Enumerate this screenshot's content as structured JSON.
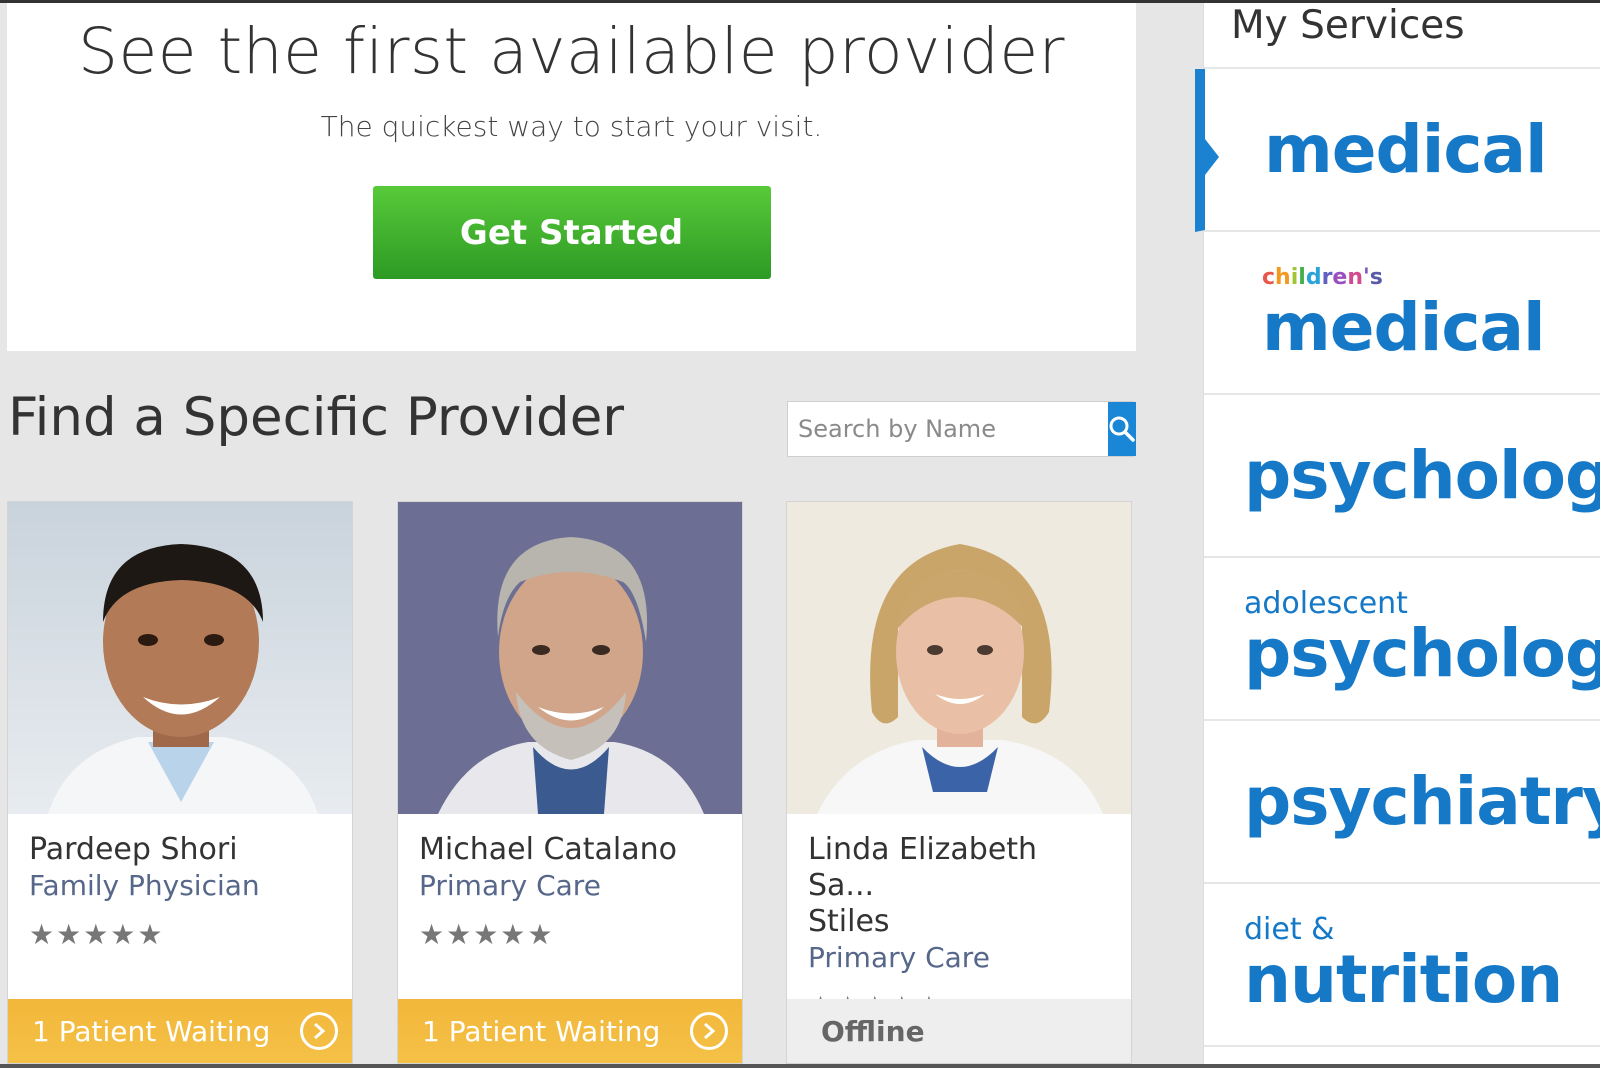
{
  "hero": {
    "title": "See the first available provider",
    "subtitle": "The quickest way to start your visit.",
    "cta_label": "Get Started"
  },
  "find": {
    "title": "Find a Specific Provider",
    "search_placeholder": "Search by Name"
  },
  "providers": [
    {
      "name": "Pardeep Shori",
      "specialty": "Family Physician",
      "stars": "★★★★★",
      "status": "1 Patient Waiting"
    },
    {
      "name": "Michael Catalano",
      "specialty": "Primary Care",
      "stars": "★★★★★",
      "status": "1 Patient Waiting"
    },
    {
      "name": "Linda Elizabeth Sa...",
      "name_line2": "Stiles",
      "specialty": "Primary Care",
      "stars": "★★★★★",
      "status": "Offline"
    }
  ],
  "services": {
    "title": "My Services",
    "items": [
      {
        "pre": "",
        "main": "medical"
      },
      {
        "pre": "children's",
        "main": "medical"
      },
      {
        "pre": "",
        "main": "psychology"
      },
      {
        "pre": "adolescent",
        "main": "psychology"
      },
      {
        "pre": "",
        "main": "psychiatry"
      },
      {
        "pre": "diet &",
        "main": "nutrition"
      }
    ]
  },
  "colors": {
    "accent": "#1579c8",
    "cta_green": "#3fb22d",
    "waiting_orange": "#f3bb3f"
  }
}
